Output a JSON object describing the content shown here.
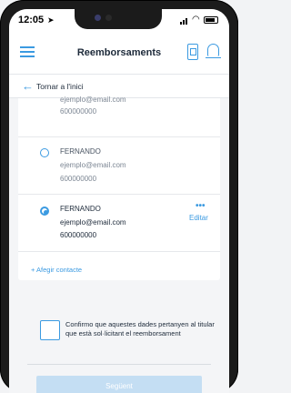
{
  "status_bar": {
    "time": "12:05"
  },
  "header": {
    "title": "Reemborsaments"
  },
  "back": {
    "label": "Tornar a l'inici"
  },
  "contacts": [
    {
      "name": "",
      "email": "ejemplo@email.com",
      "phone": "600000000",
      "selected": false
    },
    {
      "name": "FERNANDO",
      "email": "ejemplo@email.com",
      "phone": "600000000",
      "selected": false
    },
    {
      "name": "FERNANDO",
      "email": "ejemplo@email.com",
      "phone": "600000000",
      "selected": true,
      "more": "•••",
      "edit_label": "Editar"
    }
  ],
  "add_contact": {
    "label": "+ Afegir contacte"
  },
  "confirm": {
    "text": "Confirmo que aquestes dades pertanyen al titular que està sol·licitant el reemborsament"
  },
  "next_button": {
    "label": "Següent"
  },
  "colors": {
    "accent": "#3b9ae1",
    "button_disabled": "#c4def3"
  }
}
